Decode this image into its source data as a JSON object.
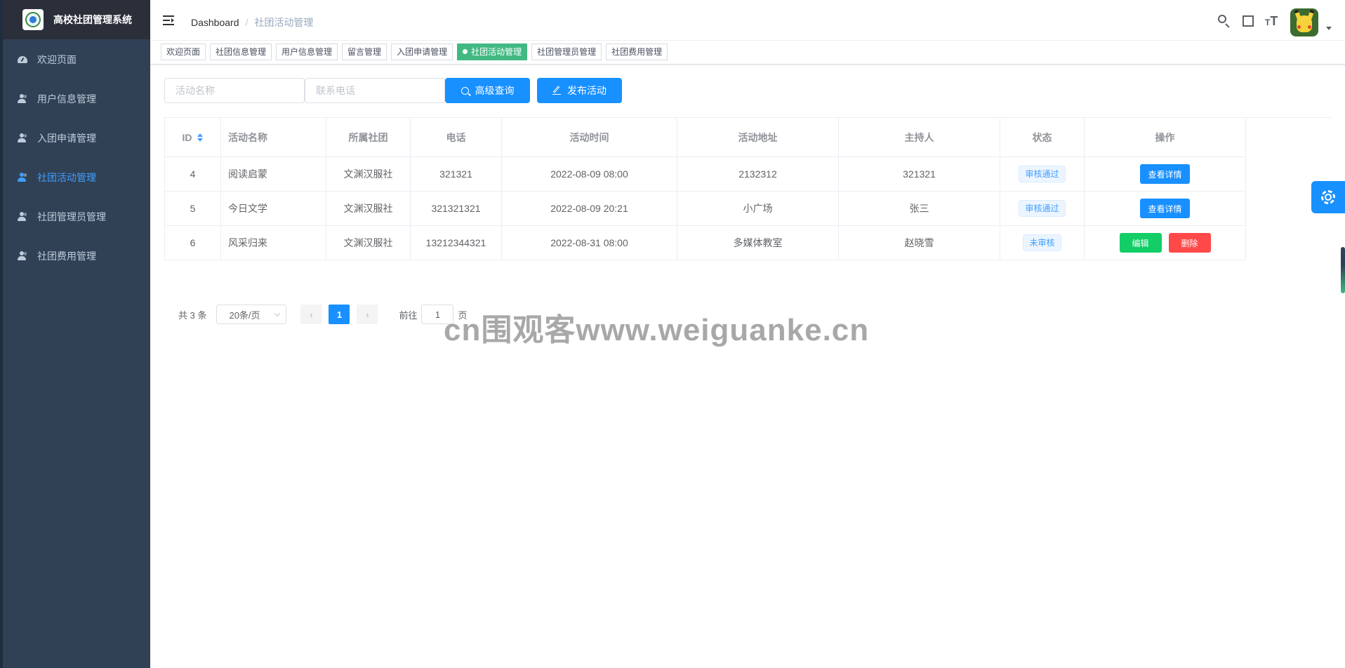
{
  "app": {
    "title": "高校社团管理系统"
  },
  "sidebar": {
    "items": [
      {
        "label": "欢迎页面",
        "icon": "dashboard-icon",
        "active": false
      },
      {
        "label": "用户信息管理",
        "icon": "user-icon",
        "active": false
      },
      {
        "label": "入团申请管理",
        "icon": "user-icon",
        "active": false
      },
      {
        "label": "社团活动管理",
        "icon": "user-icon",
        "active": true
      },
      {
        "label": "社团管理员管理",
        "icon": "user-icon",
        "active": false
      },
      {
        "label": "社团费用管理",
        "icon": "user-icon",
        "active": false
      }
    ]
  },
  "navbar": {
    "breadcrumb": {
      "root": "Dashboard",
      "separator": "/",
      "current": "社团活动管理"
    },
    "icons": [
      "hamburger-icon",
      "search-icon",
      "fullscreen-icon",
      "font-size-icon",
      "caret-down-icon"
    ]
  },
  "tags": [
    {
      "label": "欢迎页面",
      "active": false
    },
    {
      "label": "社团信息管理",
      "active": false
    },
    {
      "label": "用户信息管理",
      "active": false
    },
    {
      "label": "留言管理",
      "active": false
    },
    {
      "label": "入团申请管理",
      "active": false
    },
    {
      "label": "社团活动管理",
      "active": true
    },
    {
      "label": "社团管理员管理",
      "active": false
    },
    {
      "label": "社团费用管理",
      "active": false
    }
  ],
  "filters": {
    "name_placeholder": "活动名称",
    "phone_placeholder": "联系电话",
    "search_button": "高级查询",
    "publish_button": "发布活动"
  },
  "table": {
    "columns": [
      "ID",
      "活动名称",
      "所属社团",
      "电话",
      "活动时间",
      "活动地址",
      "主持人",
      "状态",
      "操作"
    ],
    "rows": [
      {
        "id": "4",
        "name": "阅读启蒙",
        "club": "文渊汉服社",
        "phone": "321321",
        "time": "2022-08-09 08:00",
        "address": "2132312",
        "host": "321321",
        "status": "审核通过",
        "actions": [
          "查看详情"
        ]
      },
      {
        "id": "5",
        "name": "今日文学",
        "club": "文渊汉服社",
        "phone": "321321321",
        "time": "2022-08-09 20:21",
        "address": "小广场",
        "host": "张三",
        "status": "审核通过",
        "actions": [
          "查看详情"
        ]
      },
      {
        "id": "6",
        "name": "风采归来",
        "club": "文渊汉服社",
        "phone": "13212344321",
        "time": "2022-08-31 08:00",
        "address": "多媒体教室",
        "host": "赵晓雪",
        "status": "未审核",
        "actions": [
          "编辑",
          "删除"
        ]
      }
    ]
  },
  "pagination": {
    "total": "共 3 条",
    "page_size": "20条/页",
    "current_page": "1",
    "goto_label": "前往",
    "goto_value": "1",
    "page_suffix": "页"
  },
  "watermark": "cn围观客www.weiguanke.cn",
  "colors": {
    "sidebar_bg": "#304156",
    "primary": "#1890ff",
    "tag_active": "#42b983",
    "success": "#13ce66",
    "danger": "#ff4949"
  }
}
